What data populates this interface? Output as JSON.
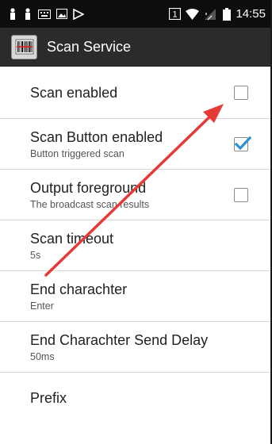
{
  "status_bar": {
    "sim_number": "1",
    "time": "14:55"
  },
  "app_bar": {
    "title": "Scan Service"
  },
  "settings": [
    {
      "title": "Scan enabled",
      "subtitle": "",
      "checkbox": "unchecked"
    },
    {
      "title": "Scan Button enabled",
      "subtitle": "Button triggered scan",
      "checkbox": "checked"
    },
    {
      "title": "Output foreground",
      "subtitle": "The broadcast scan results",
      "checkbox": "unchecked"
    },
    {
      "title": "Scan timeout",
      "subtitle": "5s"
    },
    {
      "title": "End charachter",
      "subtitle": "Enter"
    },
    {
      "title": "End Charachter Send Delay",
      "subtitle": "50ms"
    },
    {
      "title": "Prefix",
      "subtitle": ""
    }
  ],
  "colors": {
    "status_bar": "#0d0d0d",
    "app_bar": "#2b2b2b",
    "check_accent": "#2f8fd0",
    "annotation_arrow": "#e53a35"
  }
}
